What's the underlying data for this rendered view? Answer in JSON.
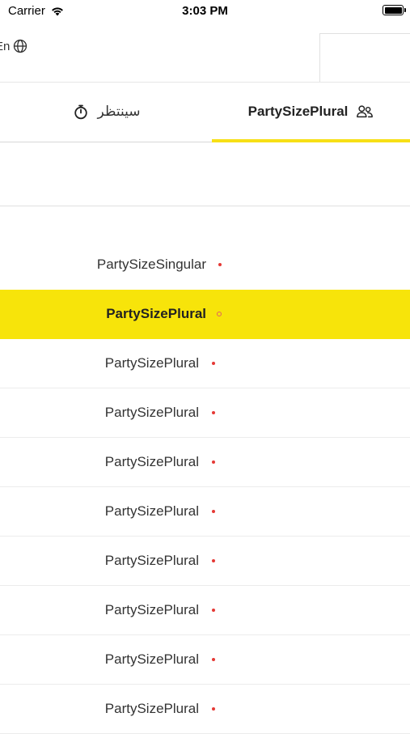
{
  "status_bar": {
    "carrier": "Carrier",
    "time": "3:03 PM"
  },
  "header": {
    "language_label": "En"
  },
  "tabs": [
    {
      "label": "سينتظر",
      "icon": "stopwatch-icon"
    },
    {
      "label": "PartySizePlural",
      "icon": "people-icon",
      "active": true
    }
  ],
  "colors": {
    "accent": "#f7e40a",
    "dot": "#e53935"
  },
  "party_list": [
    {
      "label": "PartySizeSingular"
    },
    {
      "label": "PartySizePlural",
      "selected": true
    },
    {
      "label": "PartySizePlural"
    },
    {
      "label": "PartySizePlural"
    },
    {
      "label": "PartySizePlural"
    },
    {
      "label": "PartySizePlural"
    },
    {
      "label": "PartySizePlural"
    },
    {
      "label": "PartySizePlural"
    },
    {
      "label": "PartySizePlural"
    },
    {
      "label": "PartySizePlural"
    }
  ]
}
